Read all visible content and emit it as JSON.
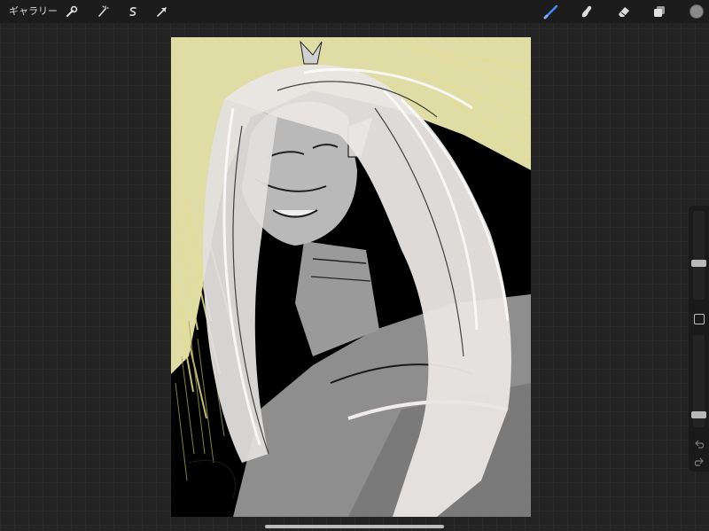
{
  "toolbar": {
    "gallery_label": "ギャラリー",
    "left_tools": [
      {
        "name": "actions",
        "icon": "wrench-icon"
      },
      {
        "name": "adjustments",
        "icon": "magic-wand-icon"
      },
      {
        "name": "selection",
        "icon": "selection-s-icon"
      },
      {
        "name": "transform",
        "icon": "arrow-cursor-icon"
      }
    ],
    "right_tools": [
      {
        "name": "brush",
        "icon": "brush-icon",
        "active": true
      },
      {
        "name": "smudge",
        "icon": "smudge-finger-icon"
      },
      {
        "name": "eraser",
        "icon": "eraser-icon"
      },
      {
        "name": "layers",
        "icon": "layers-icon"
      },
      {
        "name": "color",
        "icon": "color-swatch-icon",
        "value": "#8a8a8a"
      }
    ],
    "accent_color": "#4a8cf7"
  },
  "sidebar": {
    "brush_size_level": 0.4,
    "opacity_level": 0.1,
    "modify_icon": "square-modify-icon",
    "undo_icon": "undo-icon",
    "redo_icon": "redo-icon"
  },
  "canvas": {
    "artwork": "long-haired-figure-sketch",
    "colors": {
      "background": "#000000",
      "highlight": "#f3efb4",
      "hair": "#e9e6e4",
      "shade": "#8e8e8e"
    }
  }
}
